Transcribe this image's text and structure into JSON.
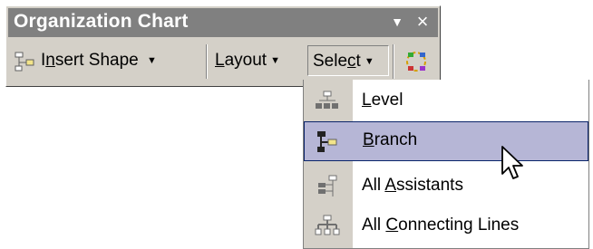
{
  "toolbar": {
    "title": "Organization Chart",
    "insert_shape": {
      "pre": "I",
      "ul": "n",
      "post": "sert Shape"
    },
    "layout": {
      "pre": "",
      "ul": "L",
      "post": "ayout"
    },
    "select": {
      "pre": "Sele",
      "ul": "c",
      "post": "t"
    }
  },
  "menu": {
    "items": [
      {
        "pre": "",
        "ul": "L",
        "post": "evel",
        "icon": "level-icon",
        "highlighted": false
      },
      {
        "pre": "",
        "ul": "B",
        "post": "ranch",
        "icon": "branch-icon",
        "highlighted": true
      },
      {
        "pre": "All ",
        "ul": "A",
        "post": "ssistants",
        "icon": "assistants-icon",
        "highlighted": false
      },
      {
        "pre": "All ",
        "ul": "C",
        "post": "onnecting Lines",
        "icon": "connecting-lines-icon",
        "highlighted": false
      }
    ]
  },
  "colors": {
    "titlebar": "#808080",
    "toolbar_face": "#d4d0c8",
    "menu_highlight": "#b6b6d6",
    "highlight_border": "#0a246a"
  }
}
